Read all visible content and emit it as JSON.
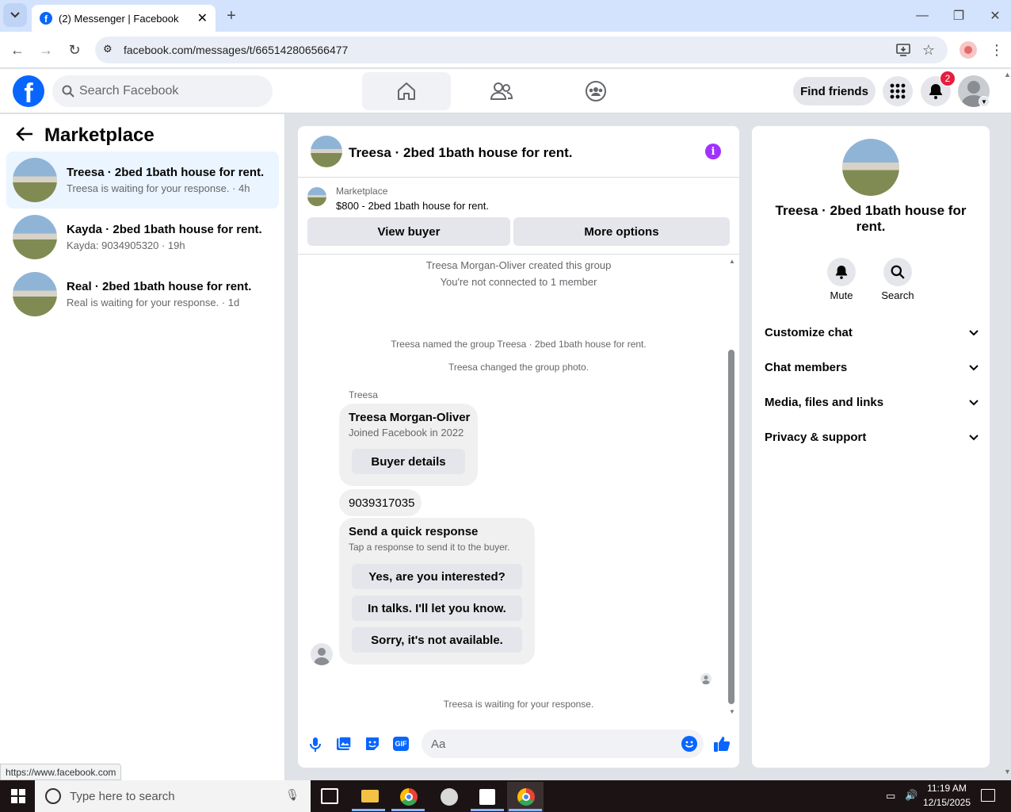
{
  "browser": {
    "tab_title": "(2) Messenger | Facebook",
    "url": "facebook.com/messages/t/665142806566477"
  },
  "header": {
    "search_placeholder": "Search Facebook",
    "find_friends": "Find friends",
    "notification_count": "2"
  },
  "sidebar": {
    "title": "Marketplace",
    "conversations": [
      {
        "title": "Treesa · 2bed 1bath house for rent.",
        "subtitle": "Treesa is waiting for your response. · 4h"
      },
      {
        "title": "Kayda · 2bed 1bath house for rent.",
        "subtitle": "Kayda: 9034905320 · 19h"
      },
      {
        "title": "Real · 2bed 1bath house for rent.",
        "subtitle": "Real is waiting for your response. · 1d"
      }
    ]
  },
  "chat": {
    "title": "Treesa · 2bed 1bath house for rent.",
    "listing_label": "Marketplace",
    "listing_price": "$800 - 2bed 1bath house for rent.",
    "view_buyer": "View buyer",
    "more_options": "More options",
    "sys1": "Treesa Morgan-Oliver created this group",
    "sys2": "You're not connected to 1 member",
    "sys3": "Treesa named the group Treesa · 2bed 1bath house for rent.",
    "sys4": "Treesa changed the group photo.",
    "sender": "Treesa",
    "card_name": "Treesa Morgan-Oliver",
    "card_joined": "Joined Facebook in 2022",
    "buyer_details": "Buyer details",
    "phone": "9039317035",
    "quick_title": "Send a quick response",
    "quick_sub": "Tap a response to send it to the buyer.",
    "quick_responses": [
      "Yes, are you interested?",
      "In talks. I'll let you know.",
      "Sorry, it's not available."
    ],
    "waiting": "Treesa is waiting for your response.",
    "composer_placeholder": "Aa"
  },
  "details": {
    "title": "Treesa · 2bed 1bath house for rent.",
    "mute": "Mute",
    "search": "Search",
    "sections": [
      "Customize chat",
      "Chat members",
      "Media, files and links",
      "Privacy & support"
    ]
  },
  "status_url": "https://www.facebook.com",
  "taskbar": {
    "search_placeholder": "Type here to search",
    "time": "11:19 AM",
    "date": "12/15/2025"
  },
  "colors": {
    "brand": "#0866ff",
    "info": "#a033ff",
    "badge": "#e41e3f"
  }
}
